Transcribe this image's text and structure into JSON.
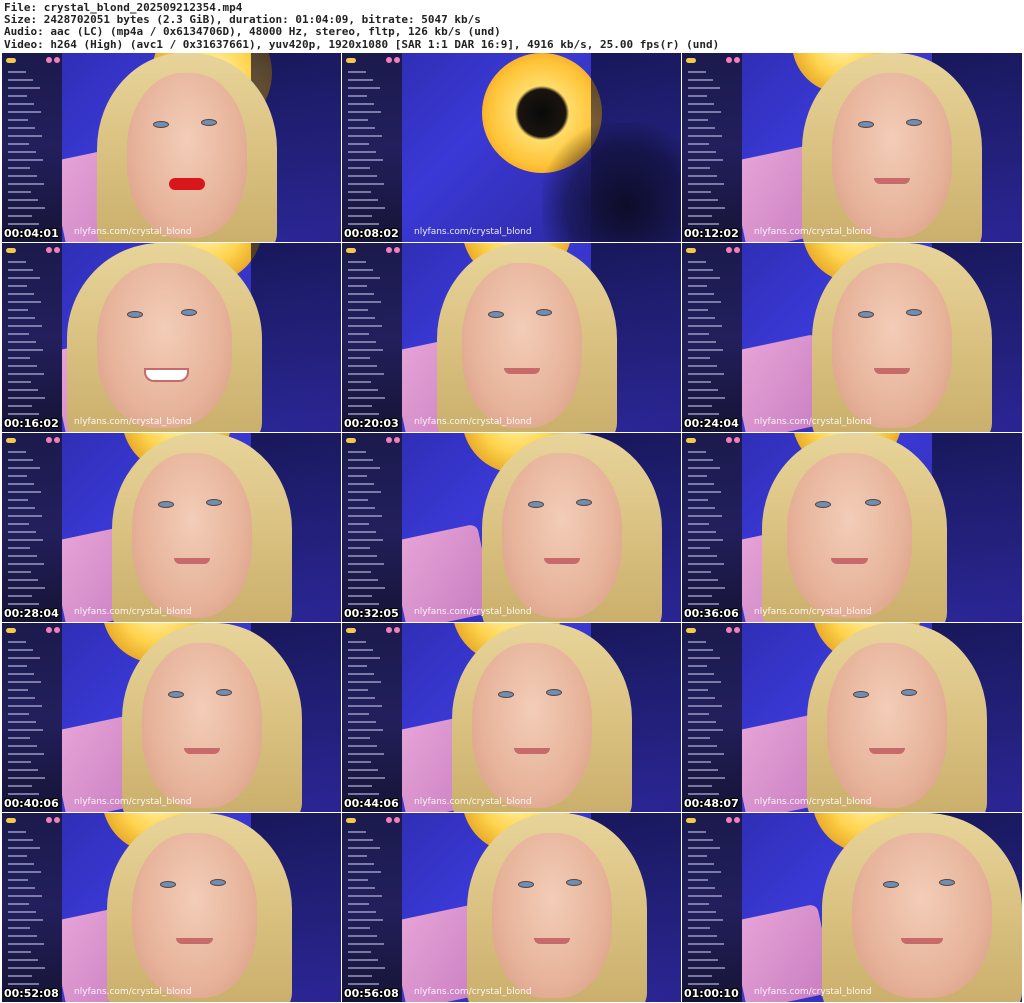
{
  "header": {
    "file": "File: crystal_blond_202509212354.mp4",
    "size": "Size: 2428702051 bytes (2.3 GiB), duration: 01:04:09, bitrate: 5047 kb/s",
    "audio": "Audio: aac (LC) (mp4a / 0x6134706D), 48000 Hz, stereo, fltp, 126 kb/s (und)",
    "video": "Video: h264 (High) (avc1 / 0x31637661), yuv420p, 1920x1080 [SAR 1:1 DAR 16:9], 4916 kb/s, 25.00 fps(r) (und)"
  },
  "watermark": "nlyfans.com/crystal_blond",
  "thumbnails": [
    {
      "timestamp": "00:04:01"
    },
    {
      "timestamp": "00:08:02"
    },
    {
      "timestamp": "00:12:02"
    },
    {
      "timestamp": "00:16:02"
    },
    {
      "timestamp": "00:20:03"
    },
    {
      "timestamp": "00:24:04"
    },
    {
      "timestamp": "00:28:04"
    },
    {
      "timestamp": "00:32:05"
    },
    {
      "timestamp": "00:36:06"
    },
    {
      "timestamp": "00:40:06"
    },
    {
      "timestamp": "00:44:06"
    },
    {
      "timestamp": "00:48:07"
    },
    {
      "timestamp": "00:52:08"
    },
    {
      "timestamp": "00:56:08"
    },
    {
      "timestamp": "01:00:10"
    }
  ],
  "colors": {
    "background": "#3a39d6",
    "overlay_panel": "#1b1a4c",
    "lamp": "#ffd34d",
    "hair": "#e8d49a",
    "timestamp_text": "#ffffff"
  }
}
